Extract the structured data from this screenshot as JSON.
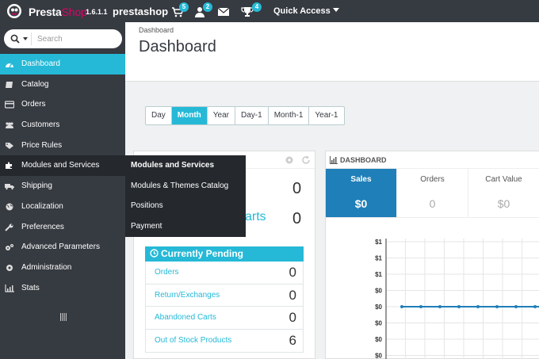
{
  "topbar": {
    "brand_presta": "Presta",
    "brand_shop": "Shop",
    "version": "1.6.1.1",
    "shop_name": "prestashop",
    "notifications": [
      {
        "icon": "cart-icon",
        "count": "5"
      },
      {
        "icon": "user-icon",
        "count": "2"
      },
      {
        "icon": "envelope-icon",
        "count": ""
      },
      {
        "icon": "trophy-icon",
        "count": "4"
      }
    ],
    "quick_access": "Quick Access"
  },
  "search": {
    "placeholder": "Search"
  },
  "sidebar": {
    "items": [
      {
        "label": "Dashboard",
        "icon": "dashboard-icon"
      },
      {
        "label": "Catalog",
        "icon": "book-icon"
      },
      {
        "label": "Orders",
        "icon": "credit-card-icon"
      },
      {
        "label": "Customers",
        "icon": "users-icon"
      },
      {
        "label": "Price Rules",
        "icon": "tag-icon"
      },
      {
        "label": "Modules and Services",
        "icon": "puzzle-icon"
      },
      {
        "label": "Shipping",
        "icon": "truck-icon"
      },
      {
        "label": "Localization",
        "icon": "globe-icon"
      },
      {
        "label": "Preferences",
        "icon": "wrench-icon"
      },
      {
        "label": "Advanced Parameters",
        "icon": "cogs-icon"
      },
      {
        "label": "Administration",
        "icon": "cog-icon"
      },
      {
        "label": "Stats",
        "icon": "bar-chart-icon"
      }
    ]
  },
  "flyout": {
    "items": [
      "Modules and Services",
      "Modules & Themes Catalog",
      "Positions",
      "Payment"
    ]
  },
  "header": {
    "breadcrumb": "Dashboard",
    "title": "Dashboard"
  },
  "periods": [
    "Day",
    "Month",
    "Year",
    "Day-1",
    "Month-1",
    "Year-1"
  ],
  "activity": {
    "stat_top": "0",
    "carts_label": "arts",
    "stat_carts": "0",
    "pending_title": "Currently Pending",
    "pending_rows": [
      {
        "label": "Orders",
        "value": "0"
      },
      {
        "label": "Return/Exchanges",
        "value": "0"
      },
      {
        "label": "Abandoned Carts",
        "value": "0"
      },
      {
        "label": "Out of Stock Products",
        "value": "6"
      }
    ]
  },
  "dashboard": {
    "title": "DASHBOARD",
    "kpis": [
      {
        "label": "Sales",
        "value": "$0"
      },
      {
        "label": "Orders",
        "value": "0"
      },
      {
        "label": "Cart Value",
        "value": "$0"
      }
    ]
  },
  "chart_data": {
    "type": "line",
    "y_tick_labels": [
      "$1",
      "$1",
      "$1",
      "$0",
      "$0",
      "$0",
      "$0",
      "$0"
    ],
    "series": [
      {
        "values": [
          0,
          0,
          0,
          0,
          0,
          0,
          0,
          0,
          0
        ]
      }
    ],
    "grid": true,
    "color": "#1f7fb8"
  },
  "colors": {
    "accent": "#25b9d7",
    "topbar": "#363a41",
    "brand_pink": "#df0067"
  }
}
